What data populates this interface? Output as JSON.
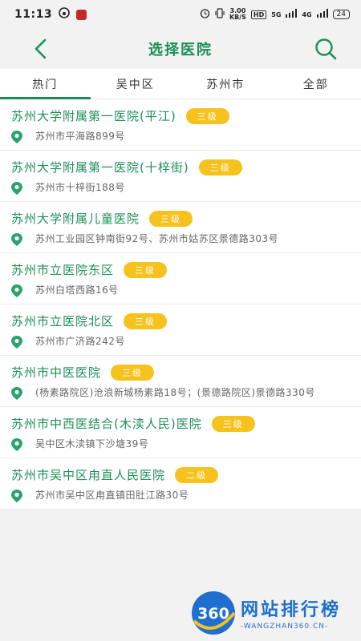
{
  "status_bar": {
    "time": "11:13",
    "speed_value": "3.00",
    "speed_unit": "KB/S",
    "hd_tag": "HD",
    "net_1": "5G",
    "net_2": "4G",
    "battery": "24"
  },
  "header": {
    "title": "选择医院",
    "accent_color": "#1c8f57"
  },
  "tabs": [
    {
      "label": "热门",
      "active": true
    },
    {
      "label": "吴中区",
      "active": false
    },
    {
      "label": "苏州市",
      "active": false
    },
    {
      "label": "全部",
      "active": false
    }
  ],
  "hospitals": [
    {
      "name": "苏州大学附属第一医院(平江)",
      "level": "三级",
      "address": "苏州市平海路899号"
    },
    {
      "name": "苏州大学附属第一医院(十梓街)",
      "level": "三级",
      "address": "苏州市十梓街188号"
    },
    {
      "name": "苏州大学附属儿童医院",
      "level": "三级",
      "address": "苏州工业园区钟南街92号、苏州市姑苏区景德路303号"
    },
    {
      "name": "苏州市立医院东区",
      "level": "三级",
      "address": "苏州白塔西路16号"
    },
    {
      "name": "苏州市立医院北区",
      "level": "三级",
      "address": "苏州市广济路242号"
    },
    {
      "name": "苏州市中医医院",
      "level": "三级",
      "address": "(杨素路院区)沧浪新城杨素路18号；(景德路院区)景德路330号"
    },
    {
      "name": "苏州市中西医结合(木渎人民)医院",
      "level": "三级",
      "address": "吴中区木渎镇下沙塘39号"
    },
    {
      "name": "苏州市吴中区甪直人民医院",
      "level": "二级",
      "address": "苏州市吴中区甪直镇田肚江路30号"
    }
  ],
  "badge_color": "#f6c21d",
  "watermark": {
    "logo_text": "360",
    "title": "网站排行榜",
    "subtitle": "-WANGZHAN360.CN-"
  }
}
